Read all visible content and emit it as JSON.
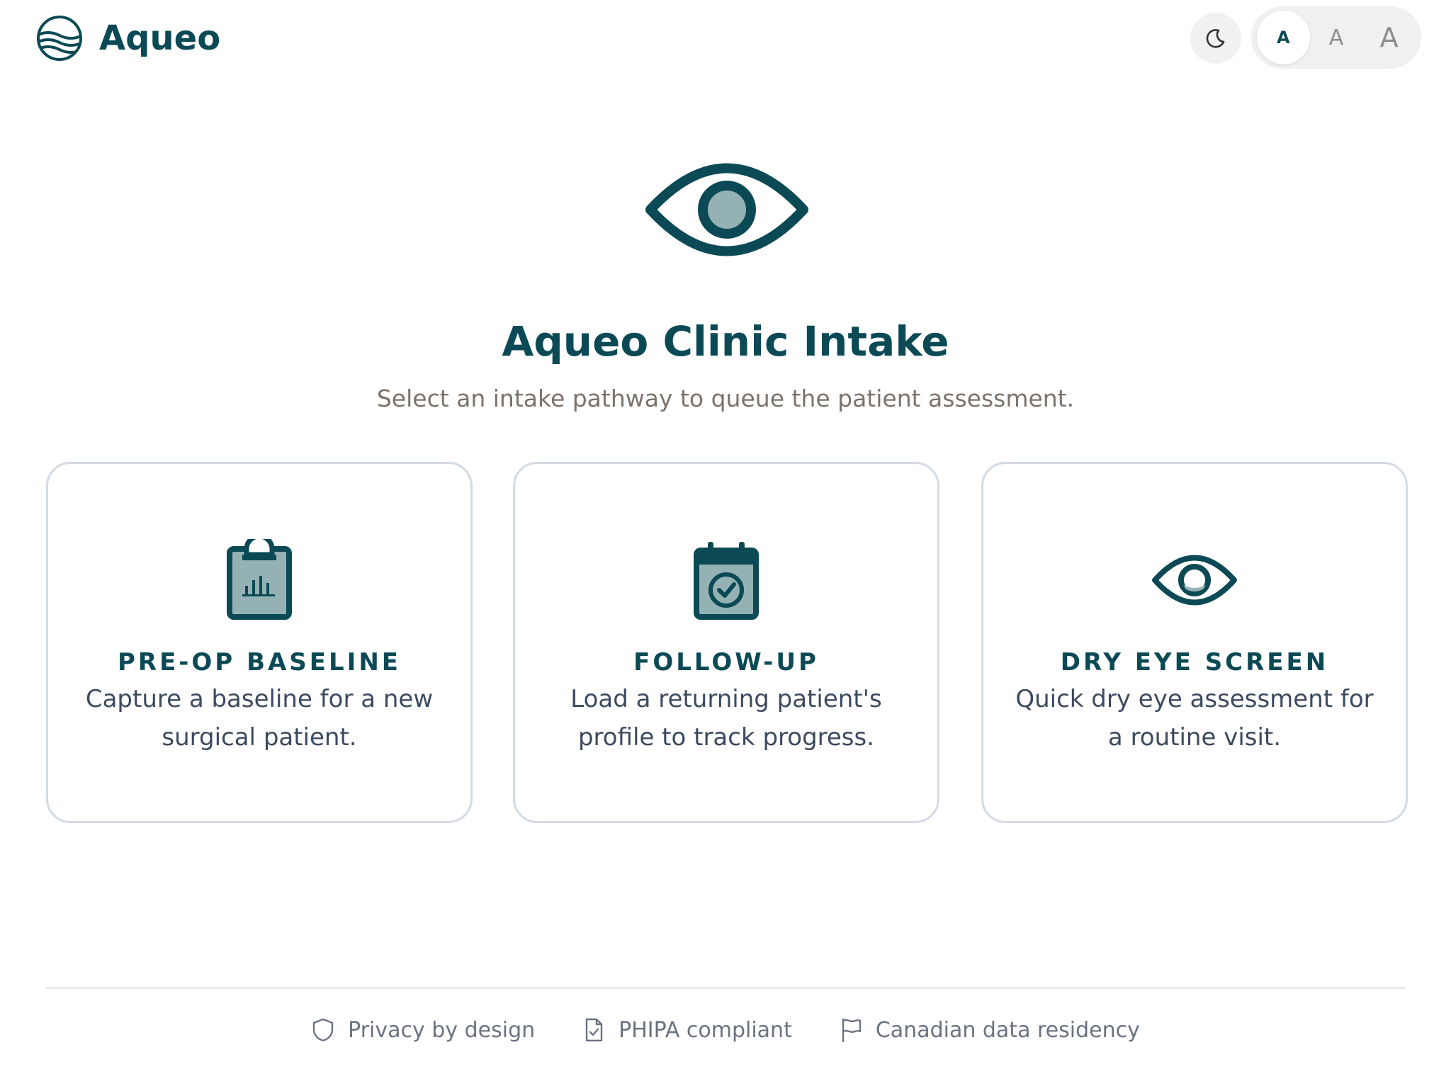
{
  "header": {
    "brand_name": "Aqueo",
    "theme_toggle_icon": "moon-icon",
    "font_size_options": [
      "A",
      "A",
      "A"
    ],
    "font_size_selected": 0
  },
  "hero": {
    "icon": "eye-icon",
    "title": "Aqueo Clinic Intake",
    "subtitle": "Select an intake pathway to queue the patient assessment."
  },
  "cards": [
    {
      "icon": "clipboard-chart-icon",
      "title": "PRE-OP BASELINE",
      "description": "Capture a baseline for a new surgical patient."
    },
    {
      "icon": "calendar-check-icon",
      "title": "FOLLOW-UP",
      "description": "Load a returning patient's profile to track progress."
    },
    {
      "icon": "eye-icon",
      "title": "DRY EYE SCREEN",
      "description": "Quick dry eye assessment for a routine visit."
    }
  ],
  "footer": {
    "items": [
      {
        "icon": "shield-icon",
        "label": "Privacy by design"
      },
      {
        "icon": "document-check-icon",
        "label": "PHIPA compliant"
      },
      {
        "icon": "flag-icon",
        "label": "Canadian data residency"
      }
    ]
  },
  "colors": {
    "primary": "#0b4a55",
    "icon_fill": "#94b1b4",
    "subtitle": "#7b736b",
    "card_text": "#3c4a60",
    "card_border": "#d4dae3",
    "footer_text": "#6b7280"
  }
}
